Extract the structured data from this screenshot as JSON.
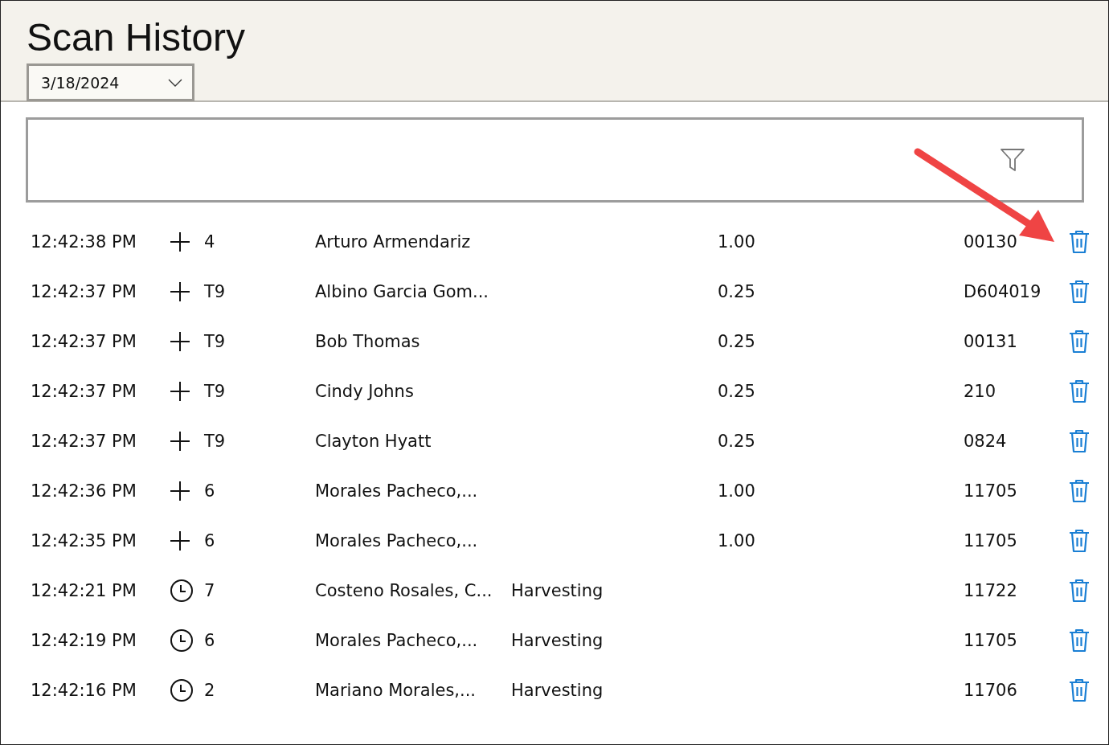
{
  "title": "Scan History",
  "date_picker": {
    "value": "3/18/2024"
  },
  "rows": [
    {
      "time": "12:42:38 PM",
      "kind": "add",
      "code": "4",
      "name": "Arturo Armendariz",
      "quantity": "1.00",
      "id": "00130"
    },
    {
      "time": "12:42:37 PM",
      "kind": "add",
      "code": "T9",
      "name": "Albino Garcia Gom...",
      "quantity": "0.25",
      "id": "D604019"
    },
    {
      "time": "12:42:37 PM",
      "kind": "add",
      "code": "T9",
      "name": "Bob Thomas",
      "quantity": "0.25",
      "id": "00131"
    },
    {
      "time": "12:42:37 PM",
      "kind": "add",
      "code": "T9",
      "name": "Cindy Johns",
      "quantity": "0.25",
      "id": "210"
    },
    {
      "time": "12:42:37 PM",
      "kind": "add",
      "code": "T9",
      "name": "Clayton Hyatt",
      "quantity": "0.25",
      "id": "0824"
    },
    {
      "time": "12:42:36 PM",
      "kind": "add",
      "code": "6",
      "name": "Morales Pacheco,...",
      "quantity": "1.00",
      "id": "11705"
    },
    {
      "time": "12:42:35 PM",
      "kind": "add",
      "code": "6",
      "name": "Morales Pacheco,...",
      "quantity": "1.00",
      "id": "11705"
    },
    {
      "time": "12:42:21 PM",
      "kind": "clock",
      "code": "7",
      "name": "Costeno Rosales, C...",
      "activity": "Harvesting",
      "id": "11722"
    },
    {
      "time": "12:42:19 PM",
      "kind": "clock",
      "code": "6",
      "name": "Morales Pacheco,...",
      "activity": "Harvesting",
      "id": "11705"
    },
    {
      "time": "12:42:16 PM",
      "kind": "clock",
      "code": "2",
      "name": "Mariano Morales,...",
      "activity": "Harvesting",
      "id": "11706"
    }
  ]
}
